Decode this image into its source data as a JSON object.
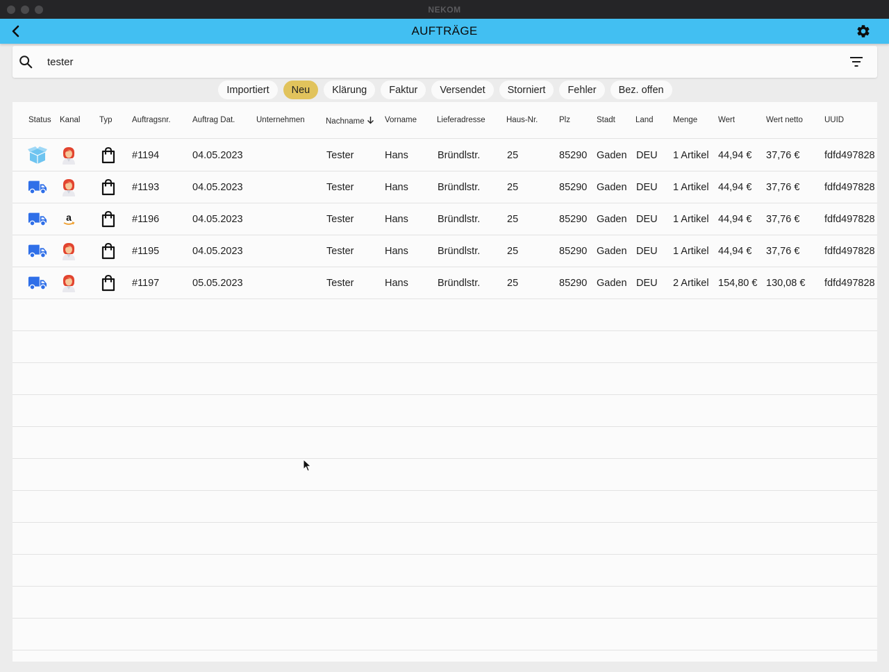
{
  "window": {
    "title": "NEKOM"
  },
  "appbar": {
    "title": "AUFTRÄGE",
    "back_icon": "back-arrow-icon",
    "settings_icon": "gear-icon"
  },
  "search": {
    "value": "tester",
    "icon": "search-icon",
    "filter_icon": "filter-icon"
  },
  "chips": [
    "Importiert",
    "Neu",
    "Klärung",
    "Faktur",
    "Versendet",
    "Storniert",
    "Fehler",
    "Bez. offen"
  ],
  "active_chip": "Neu",
  "colors": {
    "appbar": "#42bff2",
    "active_chip": "#e1c35c",
    "truck": "#2f6fe8",
    "box": "#52b4ec"
  },
  "table": {
    "columns": {
      "status": "Status",
      "kanal": "Kanal",
      "typ": "Typ",
      "auftragsnr": "Auftragsnr.",
      "datum": "Auftrag Dat.",
      "unternehmen": "Unternehmen",
      "nachname": "Nachname",
      "vorname": "Vorname",
      "lieferadresse": "Lieferadresse",
      "hausnr": "Haus-Nr.",
      "plz": "Plz",
      "stadt": "Stadt",
      "land": "Land",
      "menge": "Menge",
      "wert": "Wert",
      "wert_netto": "Wert netto",
      "uuid": "UUID"
    },
    "sort_icon": "arrow-down-icon",
    "rows": [
      {
        "status_icon": "open-box-icon",
        "kanal_icon": "shop-avatar-icon",
        "typ_icon": "shopping-bag-icon",
        "auftragsnr": "#1194",
        "datum": "04.05.2023",
        "unternehmen": "",
        "nachname": "Tester",
        "vorname": "Hans",
        "lieferadresse": "Bründlstr.",
        "hausnr": "25",
        "plz": "85290",
        "stadt": "Gaden",
        "land": "DEU",
        "menge": "1 Artikel",
        "wert": "44,94 €",
        "wert_netto": "37,76 €",
        "uuid": "fdfd497828"
      },
      {
        "status_icon": "truck-icon",
        "kanal_icon": "shop-avatar-icon",
        "typ_icon": "shopping-bag-icon",
        "auftragsnr": "#1193",
        "datum": "04.05.2023",
        "unternehmen": "",
        "nachname": "Tester",
        "vorname": "Hans",
        "lieferadresse": "Bründlstr.",
        "hausnr": "25",
        "plz": "85290",
        "stadt": "Gaden",
        "land": "DEU",
        "menge": "1 Artikel",
        "wert": "44,94 €",
        "wert_netto": "37,76 €",
        "uuid": "fdfd497828"
      },
      {
        "status_icon": "truck-icon",
        "kanal_icon": "amazon-icon",
        "typ_icon": "shopping-bag-icon",
        "auftragsnr": "#1196",
        "datum": "04.05.2023",
        "unternehmen": "",
        "nachname": "Tester",
        "vorname": "Hans",
        "lieferadresse": "Bründlstr.",
        "hausnr": "25",
        "plz": "85290",
        "stadt": "Gaden",
        "land": "DEU",
        "menge": "1 Artikel",
        "wert": "44,94 €",
        "wert_netto": "37,76 €",
        "uuid": "fdfd497828"
      },
      {
        "status_icon": "truck-icon",
        "kanal_icon": "shop-avatar-icon",
        "typ_icon": "shopping-bag-icon",
        "auftragsnr": "#1195",
        "datum": "04.05.2023",
        "unternehmen": "",
        "nachname": "Tester",
        "vorname": "Hans",
        "lieferadresse": "Bründlstr.",
        "hausnr": "25",
        "plz": "85290",
        "stadt": "Gaden",
        "land": "DEU",
        "menge": "1 Artikel",
        "wert": "44,94 €",
        "wert_netto": "37,76 €",
        "uuid": "fdfd497828"
      },
      {
        "status_icon": "truck-icon",
        "kanal_icon": "shop-avatar-icon",
        "typ_icon": "shopping-bag-icon",
        "auftragsnr": "#1197",
        "datum": "05.05.2023",
        "unternehmen": "",
        "nachname": "Tester",
        "vorname": "Hans",
        "lieferadresse": "Bründlstr.",
        "hausnr": "25",
        "plz": "85290",
        "stadt": "Gaden",
        "land": "DEU",
        "menge": "2 Artikel",
        "wert": "154,80 €",
        "wert_netto": "130,08 €",
        "uuid": "fdfd497828"
      }
    ]
  }
}
